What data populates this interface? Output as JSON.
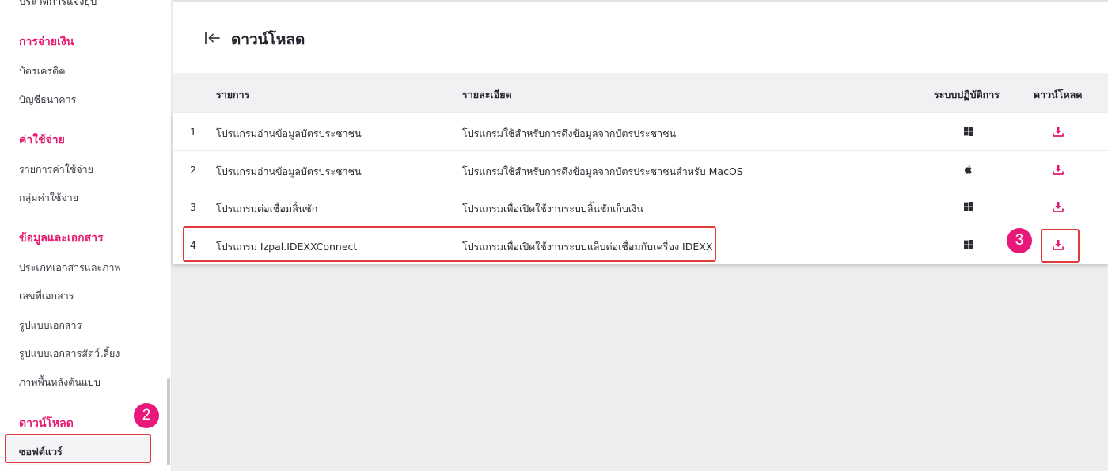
{
  "sidebar": {
    "cut_item": "ประวัติการแจ้งยุบ",
    "sections": [
      {
        "title": "การจ่ายเงิน",
        "items": [
          "บัตรเครดิต",
          "บัญชีธนาคาร"
        ]
      },
      {
        "title": "ค่าใช้จ่าย",
        "items": [
          "รายการค่าใช้จ่าย",
          "กลุ่มค่าใช้จ่าย"
        ]
      },
      {
        "title": "ข้อมูลและเอกสาร",
        "items": [
          "ประเภทเอกสารและภาพ",
          "เลขที่เอกสาร",
          "รูปแบบเอกสาร",
          "รูปแบบเอกสารสัตว์เลี้ยง",
          "ภาพพื้นหลังต้นแบบ"
        ]
      },
      {
        "title": "ดาวน์โหลด",
        "items": [
          "ซอฟต์แวร์"
        ]
      }
    ]
  },
  "header": {
    "back_icon": "collapse-left-arrow-icon",
    "title": "ดาวน์โหลด"
  },
  "table": {
    "columns": [
      "รายการ",
      "รายละเอียด",
      "ระบบปฏิบัติการ",
      "ดาวน์โหลด"
    ],
    "rows": [
      {
        "no": "1",
        "name": "โปรแกรมอ่านข้อมูลบัตรประชาชน",
        "detail": "โปรแกรมใช้สำหรับการดึงข้อมูลจากบัตรประชาชน",
        "os": "windows-icon"
      },
      {
        "no": "2",
        "name": "โปรแกรมอ่านข้อมูลบัตรประชาชน",
        "detail": "โปรแกรมใช้สำหรับการดึงข้อมูลจากบัตรประชาชนสำหรับ MacOS",
        "os": "apple-icon"
      },
      {
        "no": "3",
        "name": "โปรแกรมต่อเชื่อมลิ้นชัก",
        "detail": "โปรแกรมเพื่อเปิดใช้งานระบบลิ้นชักเก็บเงิน",
        "os": "windows-icon"
      },
      {
        "no": "4",
        "name": "โปรแกรม Izpal.IDEXXConnect",
        "detail": "โปรแกรมเพื่อเปิดใช้งานระบบแล็บต่อเชื่อมกับเครื่อง IDEXX",
        "os": "windows-icon"
      }
    ],
    "download_icon": "download-icon"
  },
  "annotations": {
    "badge_sidebar": "2",
    "badge_download": "3"
  },
  "colors": {
    "accent": "#e5176f",
    "highlight_box": "#e03a3a",
    "badge": "#e8187a",
    "table_header_bg": "#f1f1f4"
  }
}
